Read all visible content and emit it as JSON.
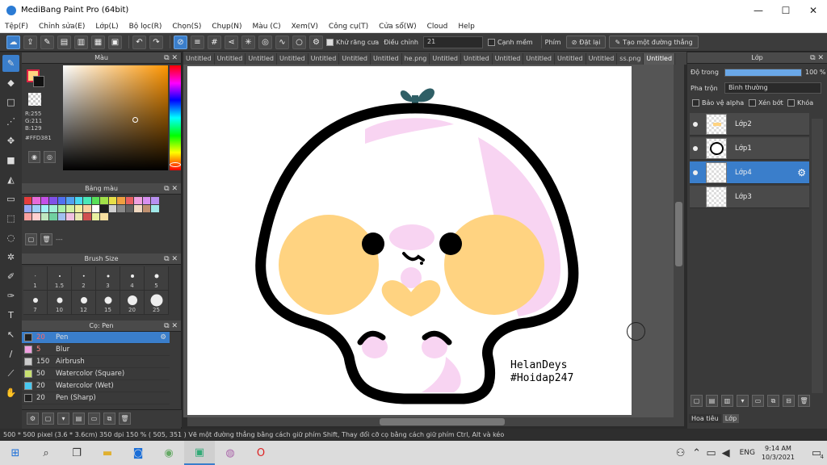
{
  "window": {
    "title": "MediBang Paint Pro (64bit)",
    "controls": [
      "—",
      "☐",
      "✕"
    ]
  },
  "menu": [
    "Tệp(F)",
    "Chỉnh sửa(E)",
    "Lớp(L)",
    "Bộ lọc(R)",
    "Chọn(S)",
    "Chụp(N)",
    "Màu (C)",
    "Xem(V)",
    "Công cụ(T)",
    "Cửa sổ(W)",
    "Cloud",
    "Help"
  ],
  "toolbar": {
    "antialias_label": "Khử răng cưa",
    "correction_label": "Điều chỉnh",
    "correction_value": "21",
    "edge_label": "Cạnh mềm",
    "phim_label": "Phím",
    "reset_label": "Đặt lại",
    "line_label": "Tạo một đường thẳng"
  },
  "color_panel": {
    "title": "Màu",
    "r": "R:255",
    "g": "G:211",
    "b": "B:129",
    "hex": "#FFD381",
    "fg_color": "#FFD381"
  },
  "palette_panel": {
    "title": "Bảng màu",
    "footer_text": "---",
    "swatches": [
      "#e53c3c",
      "#e86ad8",
      "#c54fe8",
      "#8050e8",
      "#5070f0",
      "#50a0f0",
      "#48d8f0",
      "#48e8b8",
      "#58e058",
      "#a0e048",
      "#e8e048",
      "#f0a040",
      "#e86060",
      "#f0a0e0",
      "#d890f0",
      "#b890f0",
      "#98a8f8",
      "#a0d0f8",
      "#a0f0f8",
      "#a0f0d8",
      "#a8f0a8",
      "#d0f0a0",
      "#f0f0a0",
      "#f8d0a0",
      "#ffffff",
      "#1e1e1e",
      "#d0d0d0",
      "#888888",
      "#606060",
      "#f0d8c0",
      "#c09070",
      "#a0e8e8",
      "#f8a0a0",
      "#ffd0d0",
      "#c0e8c0",
      "#70d0a0",
      "#a0c0f0",
      "#f0c0e0",
      "#e8e8b0",
      "#d05050",
      "#e8f0a0",
      "#f8e0a0"
    ]
  },
  "brush_size_panel": {
    "title": "Brush Size",
    "sizes": [
      "1",
      "1.5",
      "2",
      "3",
      "4",
      "5",
      "7",
      "10",
      "12",
      "15",
      "20",
      "25"
    ]
  },
  "brush_panel": {
    "title": "Cọ: Pen",
    "items": [
      {
        "size": "20",
        "name": "Pen",
        "color": "#222222"
      },
      {
        "size": "5",
        "name": "Blur",
        "color": "#f0a0e0"
      },
      {
        "size": "150",
        "name": "Airbrush",
        "color": "#cccccc"
      },
      {
        "size": "50",
        "name": "Watercolor (Square)",
        "color": "#c8e070"
      },
      {
        "size": "20",
        "name": "Watercolor (Wet)",
        "color": "#48c8f0"
      },
      {
        "size": "20",
        "name": "Pen (Sharp)",
        "color": "#222222"
      }
    ]
  },
  "tabs": [
    "Untitled",
    "Untitled",
    "Untitled",
    "Untitled",
    "Untitled",
    "Untitled",
    "Untitled",
    "he.png",
    "Untitled",
    "Untitled",
    "Untitled",
    "Untitled",
    "Untitled",
    "Untitled",
    "ss.png",
    "Untitled"
  ],
  "canvas": {
    "signature_line1": "HelanDeys",
    "signature_line2": "#Hoidap247"
  },
  "status": "500 * 500 pixel  (3.6 * 3.6cm)  350 dpi  150 %  ( 505, 351 )  Vẽ một đường thẳng bằng cách giữ phím Shift, Thay đổi cỡ cọ bằng cách giữ phím Ctrl, Alt và kéo",
  "layer_panel": {
    "title": "Lớp",
    "opacity_label": "Độ trong",
    "opacity_value": "100 %",
    "blend_label": "Pha trộn",
    "blend_value": "Bình thường",
    "protect_alpha": "Bảo vệ alpha",
    "clipping": "Xén bớt",
    "lock": "Khóa",
    "layers": [
      "Lớp2",
      "Lớp1",
      "Lớp4",
      "Lớp3"
    ],
    "bottom_tabs": [
      "Hoa tiêu",
      "Lớp"
    ]
  },
  "taskbar": {
    "time": "9:14 AM",
    "date": "10/3/2021",
    "lang": "ENG",
    "notif": "4"
  }
}
